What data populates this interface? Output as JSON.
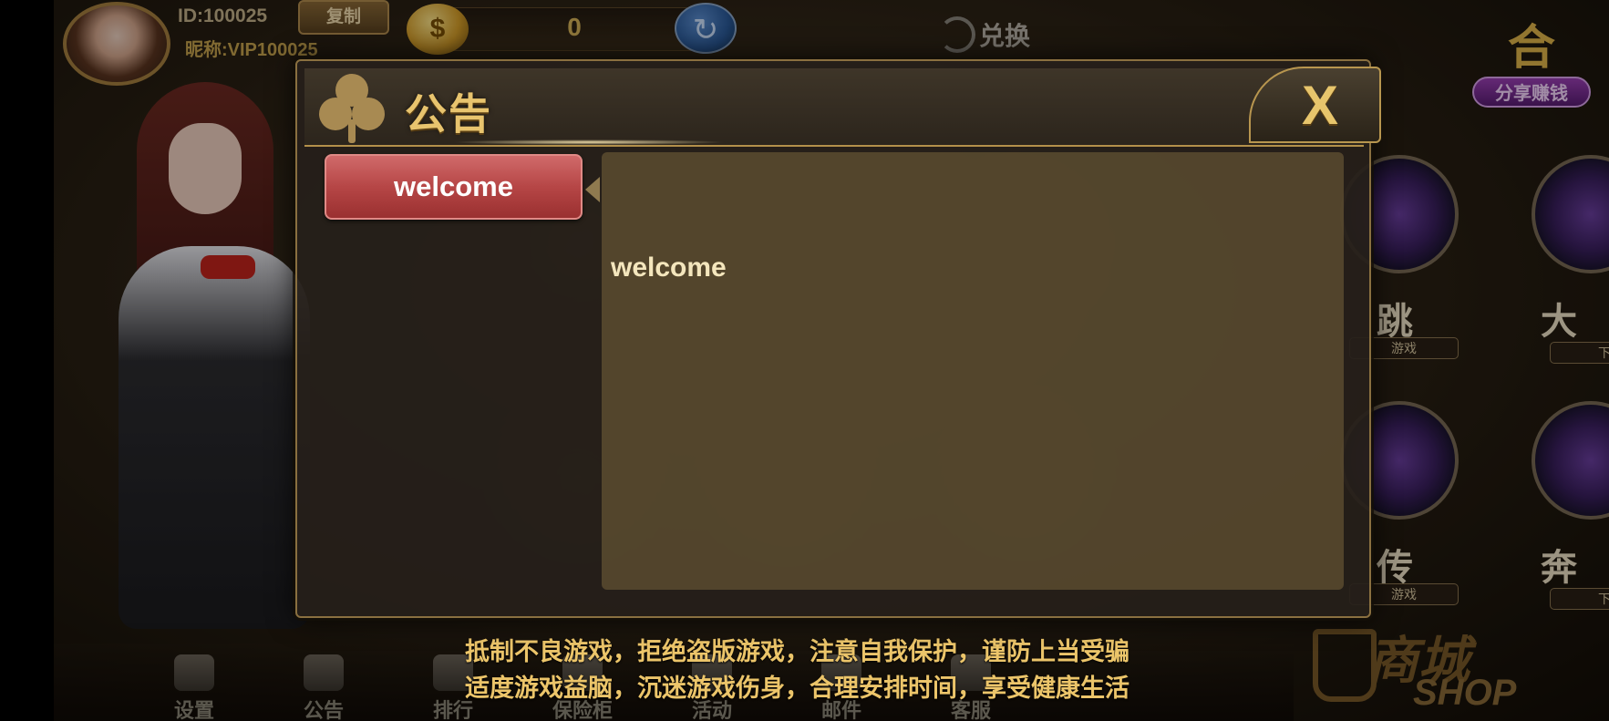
{
  "profile": {
    "id_text": "ID:100025",
    "nickname_text": "昵称:VIP100025",
    "copy_label": "复制"
  },
  "wallet": {
    "coin_symbol": "$",
    "coin_amount": "0",
    "exchange_label": "兑换"
  },
  "share": {
    "title": "合",
    "tag": "分享赚钱"
  },
  "right_games": [
    {
      "name": "跳",
      "plate": "游戏"
    },
    {
      "name": "大",
      "plate": "下"
    },
    {
      "name": "传",
      "plate": "游戏"
    },
    {
      "name": "奔",
      "plate": "下"
    }
  ],
  "bottom_nav": [
    {
      "label": "设置",
      "icon": "gear-icon"
    },
    {
      "label": "公告",
      "icon": "megaphone-icon"
    },
    {
      "label": "排行",
      "icon": "ranking-icon"
    },
    {
      "label": "保险柜",
      "icon": "safe-icon"
    },
    {
      "label": "活动",
      "icon": "event-icon"
    },
    {
      "label": "邮件",
      "icon": "mail-icon"
    },
    {
      "label": "客服",
      "icon": "support-icon"
    }
  ],
  "shop": {
    "label_cn": "商城",
    "label_en": "SHOP"
  },
  "notice": {
    "line1": "抵制不良游戏，拒绝盗版游戏，注意自我保护，谨防上当受骗",
    "line2": "适度游戏益脑，沉迷游戏伤身，合理安排时间，享受健康生活"
  },
  "dialog": {
    "title": "公告",
    "close_label": "X",
    "tabs": [
      {
        "label": "welcome",
        "selected": true
      }
    ],
    "content": "welcome"
  },
  "colors": {
    "accent_gold": "#e8c46e",
    "tab_selected": "#b64646",
    "panel_bg": "#786438"
  }
}
